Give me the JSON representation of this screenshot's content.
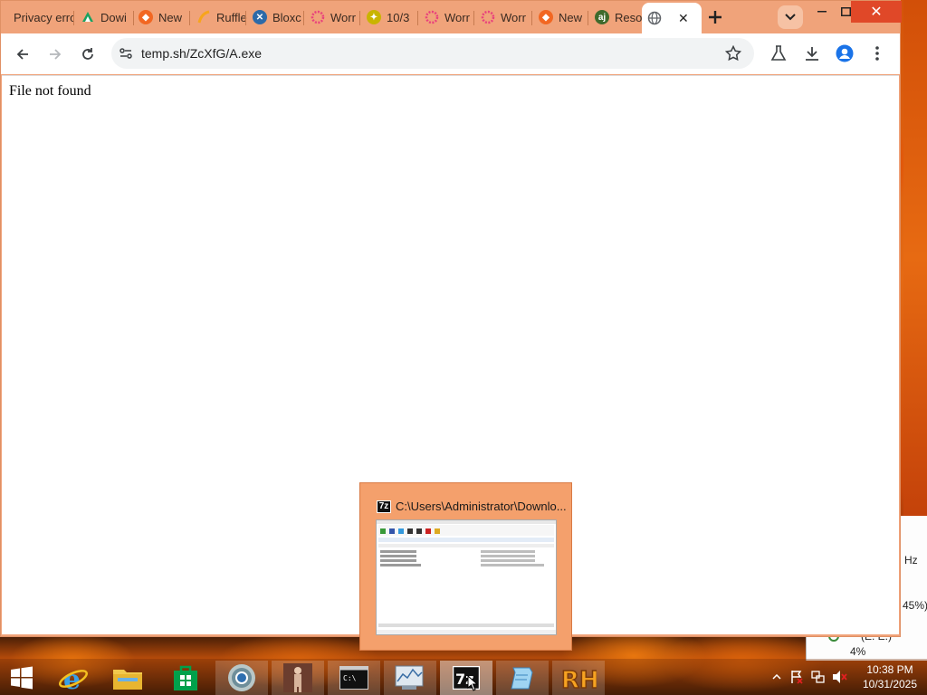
{
  "browser": {
    "tabs": [
      {
        "title": "Privacy erro",
        "icon": "warning-icon",
        "color": "#d93025"
      },
      {
        "title": "Dowi",
        "icon": "download-logo-icon",
        "color": "#1aa260"
      },
      {
        "title": "New",
        "icon": "brave-icon",
        "color": "#f26722"
      },
      {
        "title": "Ruffle",
        "icon": "ruffle-icon",
        "color": "#f7a51c"
      },
      {
        "title": "Bloxc",
        "icon": "bloxstrap-icon",
        "color": "#2d6aa8"
      },
      {
        "title": "Worr",
        "icon": "flower-icon",
        "color": "#e8417c"
      },
      {
        "title": "10/3",
        "icon": "gemini-icon",
        "color": "#c9b400"
      },
      {
        "title": "Worr",
        "icon": "flower-icon",
        "color": "#e8417c"
      },
      {
        "title": "Worr",
        "icon": "flower-icon",
        "color": "#e8417c"
      },
      {
        "title": "New",
        "icon": "brave-icon",
        "color": "#f26722"
      },
      {
        "title": "Reso",
        "icon": "aj-icon",
        "color": "#3f6a2c"
      },
      {
        "title": "",
        "icon": "globe-icon",
        "color": "#5f6368",
        "active": true
      }
    ],
    "address": "temp.sh/ZcXfG/A.exe"
  },
  "page": {
    "message": "File not found"
  },
  "preview": {
    "title": "C:\\Users\\Administrator\\Downlo...",
    "app_badge": "7z"
  },
  "taskbar": {
    "items": [
      {
        "name": "start",
        "icon": "windows-logo-icon"
      },
      {
        "name": "internet-explorer",
        "icon": "ie-icon"
      },
      {
        "name": "file-explorer",
        "icon": "folder-icon"
      },
      {
        "name": "store",
        "icon": "store-icon"
      },
      {
        "name": "chrome",
        "icon": "chrome-icon"
      },
      {
        "name": "app-figure",
        "icon": "figure-icon"
      },
      {
        "name": "cmd",
        "icon": "cmd-icon",
        "label": "C:\\"
      },
      {
        "name": "resource-monitor",
        "icon": "monitor-chart-icon"
      },
      {
        "name": "7zip",
        "icon": "sevenzip-icon",
        "label": "7z"
      },
      {
        "name": "notepad",
        "icon": "notepad-icon"
      },
      {
        "name": "rh",
        "icon": "rh-icon",
        "label": "RH"
      }
    ],
    "clock_time": "10:38 PM",
    "clock_date": "10/31/2025"
  },
  "background_window": {
    "hz": "Hz",
    "percent": "45%)",
    "drive": "(E: E:)",
    "drive_partial": "",
    "drive_percent": "4%"
  }
}
